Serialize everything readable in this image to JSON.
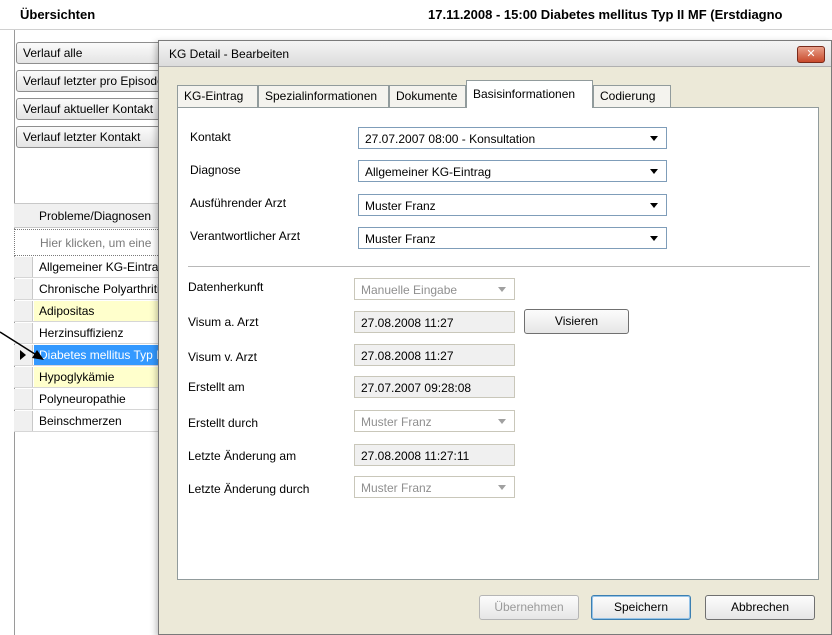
{
  "header": {
    "overview_title": "Übersichten",
    "record_title": "17.11.2008 - 15:00 Diabetes mellitus Typ II MF (Erstdiagno"
  },
  "left_panel": {
    "buttons": [
      "Verlauf alle",
      "Verlauf letzter pro Episode",
      "Verlauf aktueller Kontakt",
      "Verlauf letzter Kontakt"
    ],
    "grid_header": "Probleme/Diagnosen",
    "filter_placeholder": "Hier klicken, um eine",
    "rows": [
      {
        "label": "Allgemeiner KG-Eintrag",
        "style": "normal"
      },
      {
        "label": "Chronische Polyarthritis",
        "style": "normal"
      },
      {
        "label": "Adipositas",
        "style": "yellow"
      },
      {
        "label": "Herzinsuffizienz",
        "style": "normal"
      },
      {
        "label": "Diabetes mellitus Typ II",
        "style": "selected"
      },
      {
        "label": "Hypoglykämie",
        "style": "yellow"
      },
      {
        "label": "Polyneuropathie",
        "style": "normal"
      },
      {
        "label": "Beinschmerzen",
        "style": "normal"
      }
    ]
  },
  "dialog": {
    "title": "KG Detail - Bearbeiten",
    "close_label": "✕",
    "tabs": [
      "KG-Eintrag",
      "Spezialinformationen",
      "Dokumente",
      "Basisinformationen",
      "Codierung"
    ],
    "active_tab": "Basisinformationen",
    "fields": {
      "kontakt": {
        "label": "Kontakt",
        "value": "27.07.2007 08:00 - Konsultation"
      },
      "diagnose": {
        "label": "Diagnose",
        "value": "Allgemeiner KG-Eintrag"
      },
      "ausf_arzt": {
        "label": "Ausführender Arzt",
        "value": "Muster Franz"
      },
      "verantw_arzt": {
        "label": "Verantwortlicher Arzt",
        "value": "Muster Franz"
      },
      "datenherkunft": {
        "label": "Datenherkunft",
        "value": "Manuelle Eingabe"
      },
      "visum_a": {
        "label": "Visum a. Arzt",
        "value": "27.08.2008 11:27"
      },
      "visum_v": {
        "label": "Visum v. Arzt",
        "value": "27.08.2008 11:27"
      },
      "erstellt_am": {
        "label": "Erstellt am",
        "value": "27.07.2007 09:28:08"
      },
      "erstellt_durch": {
        "label": "Erstellt durch",
        "value": "Muster Franz"
      },
      "letzte_aenderung_am": {
        "label": "Letzte Änderung am",
        "value": "27.08.2008 11:27:11"
      },
      "letzte_aenderung_durch": {
        "label": "Letzte Änderung durch",
        "value": "Muster Franz"
      }
    },
    "visieren_label": "Visieren",
    "buttons": {
      "apply": "Übernehmen",
      "save": "Speichern",
      "cancel": "Abbrechen"
    }
  },
  "colors": {
    "selection": "#3399ff",
    "highlight_row": "#ffffcc",
    "dialog_bg": "#ece9d8"
  }
}
